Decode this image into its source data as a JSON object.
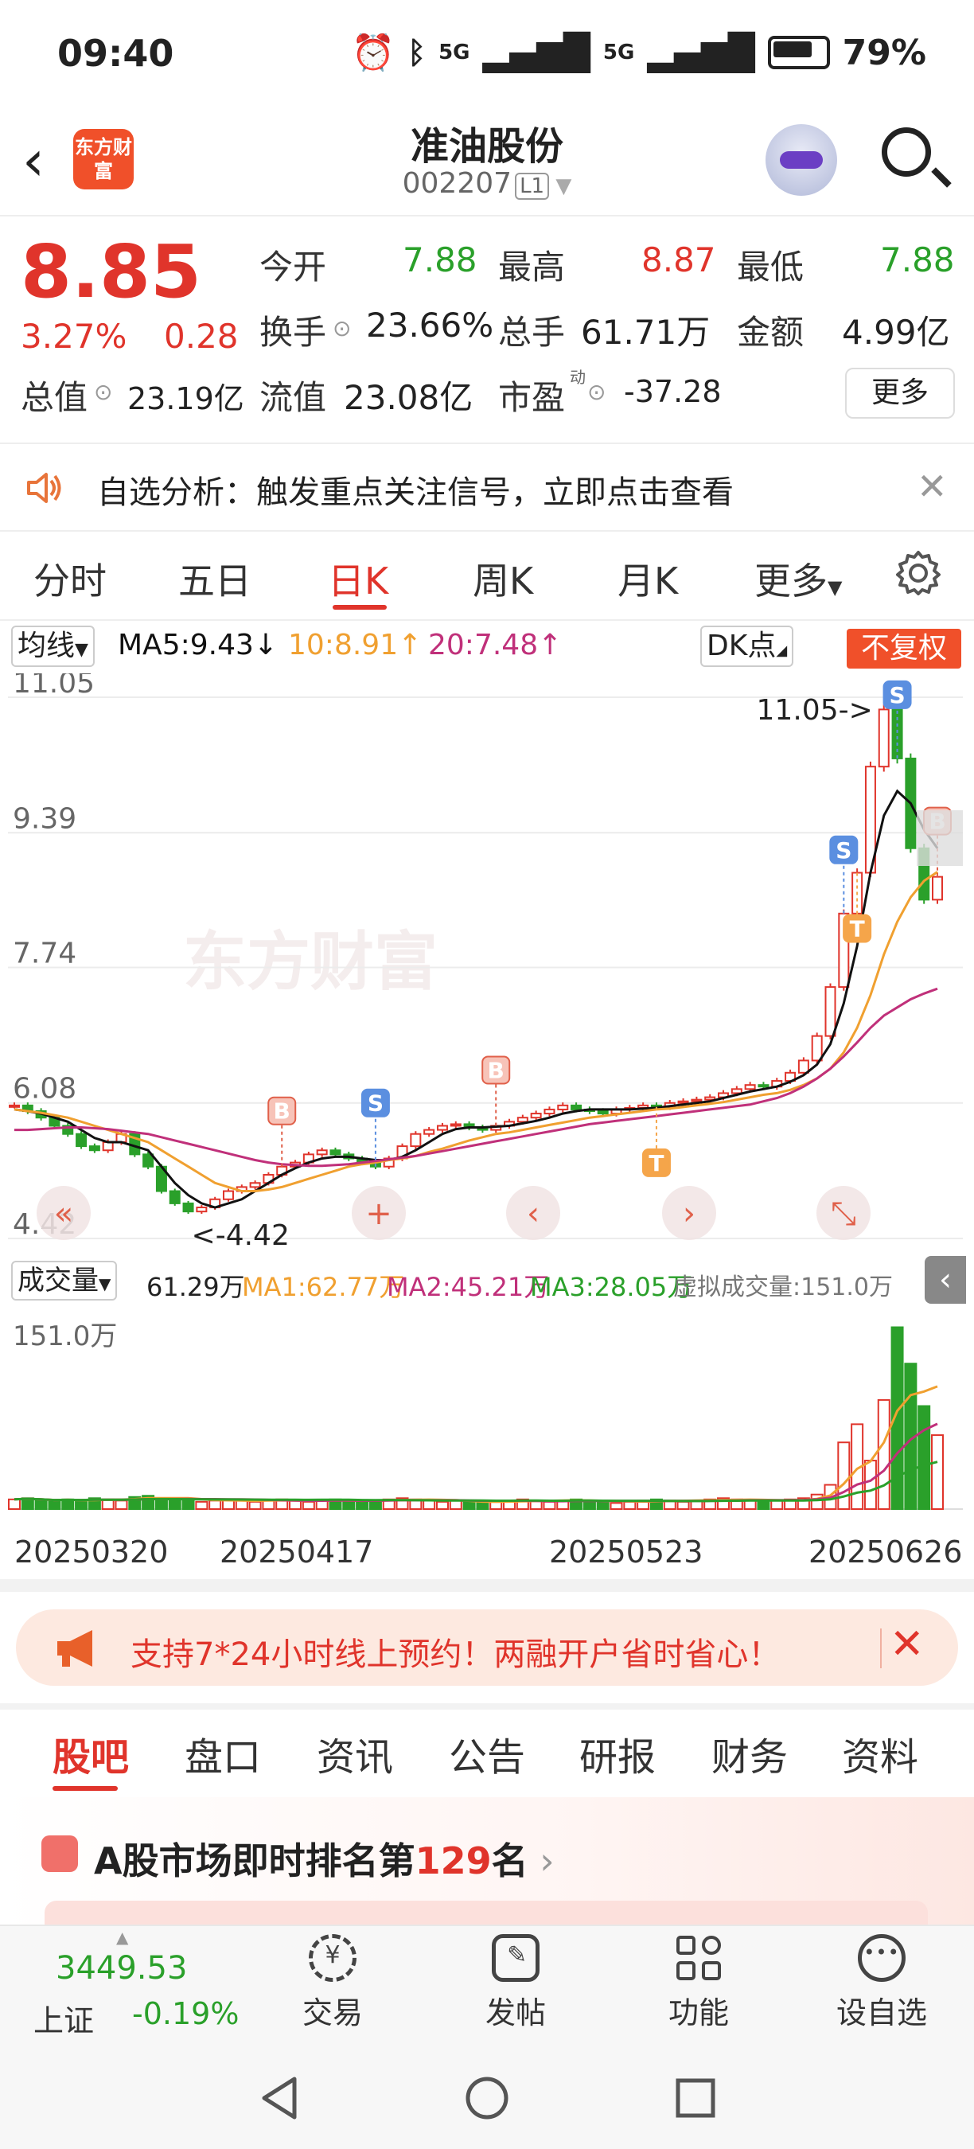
{
  "status_bar": {
    "time": "09:40",
    "battery": "79%",
    "net1": "5G",
    "net2": "5G"
  },
  "header": {
    "title": "准油股份",
    "code": "002207",
    "level": "L1",
    "logo_text": "东方财富"
  },
  "quote": {
    "price": "8.85",
    "pct": "3.27%",
    "change": "0.28",
    "open_label": "今开",
    "open": "7.88",
    "high_label": "最高",
    "high": "8.87",
    "low_label": "最低",
    "low": "7.88",
    "turnover_label": "换手",
    "turnover": "23.66%",
    "volume_label": "总手",
    "volume": "61.71万",
    "amount_label": "金额",
    "amount": "4.99亿",
    "mktcap_label": "总值",
    "mktcap": "23.19亿",
    "float_label": "流值",
    "float": "23.08亿",
    "pe_label": "市盈",
    "pe_sup": "动",
    "pe": "-37.28",
    "more": "更多"
  },
  "notice": {
    "text": "自选分析：触发重点关注信号，立即点击查看"
  },
  "kline_tabs": [
    "分时",
    "五日",
    "日K",
    "周K",
    "月K",
    "更多"
  ],
  "ma_bar": {
    "selector": "均线",
    "ma5": "MA5:9.43",
    "ma10": "10:8.91",
    "ma20": "20:7.48",
    "dk": "DK点",
    "fq": "不复权"
  },
  "colors": {
    "up": "#e0342b",
    "down": "#2aa02a",
    "ma5": "#111111",
    "ma10": "#f0a030",
    "ma20": "#c0307a",
    "accent": "#f0502a"
  },
  "chart_data": {
    "type": "candlestick",
    "y_ticks": [
      "11.05",
      "9.39",
      "7.74",
      "6.08",
      "4.42"
    ],
    "ylim": [
      4.42,
      11.05
    ],
    "max_label": "11.05->",
    "min_label": "<-4.42",
    "x_labels": [
      "20250320",
      "20250417",
      "20250523",
      "20250626"
    ],
    "closes": [
      6.05,
      5.98,
      5.9,
      5.8,
      5.7,
      5.55,
      5.5,
      5.6,
      5.7,
      5.45,
      5.3,
      5.0,
      4.85,
      4.75,
      4.8,
      4.9,
      5.0,
      5.05,
      5.1,
      5.2,
      5.3,
      5.35,
      5.45,
      5.5,
      5.45,
      5.4,
      5.35,
      5.3,
      5.4,
      5.55,
      5.7,
      5.75,
      5.8,
      5.82,
      5.78,
      5.75,
      5.8,
      5.85,
      5.9,
      5.95,
      6.0,
      6.05,
      6.0,
      5.98,
      5.95,
      6.0,
      6.02,
      6.05,
      6.03,
      6.08,
      6.1,
      6.12,
      6.15,
      6.2,
      6.25,
      6.3,
      6.28,
      6.35,
      6.45,
      6.6,
      6.9,
      7.5,
      8.4,
      8.9,
      10.2,
      10.9,
      10.3,
      9.2,
      8.57,
      8.85
    ],
    "ma5": [
      6.0,
      5.98,
      5.95,
      5.9,
      5.85,
      5.75,
      5.65,
      5.6,
      5.6,
      5.55,
      5.5,
      5.3,
      5.1,
      4.95,
      4.85,
      4.8,
      4.85,
      4.9,
      5.0,
      5.1,
      5.2,
      5.28,
      5.35,
      5.4,
      5.42,
      5.42,
      5.4,
      5.38,
      5.38,
      5.42,
      5.5,
      5.6,
      5.7,
      5.76,
      5.78,
      5.78,
      5.79,
      5.8,
      5.83,
      5.86,
      5.9,
      5.95,
      5.98,
      6.0,
      6.0,
      6.0,
      6.0,
      6.01,
      6.02,
      6.04,
      6.06,
      6.08,
      6.1,
      6.14,
      6.18,
      6.22,
      6.25,
      6.28,
      6.34,
      6.42,
      6.55,
      6.8,
      7.3,
      8.0,
      8.9,
      9.6,
      9.9,
      9.75,
      9.43,
      9.2
    ],
    "ma10": [
      6.0,
      5.98,
      5.96,
      5.93,
      5.9,
      5.85,
      5.8,
      5.75,
      5.7,
      5.65,
      5.6,
      5.5,
      5.4,
      5.3,
      5.2,
      5.1,
      5.05,
      5.0,
      5.0,
      5.02,
      5.05,
      5.1,
      5.15,
      5.2,
      5.25,
      5.3,
      5.33,
      5.35,
      5.38,
      5.4,
      5.43,
      5.48,
      5.52,
      5.57,
      5.62,
      5.66,
      5.7,
      5.72,
      5.75,
      5.78,
      5.81,
      5.84,
      5.87,
      5.9,
      5.92,
      5.94,
      5.96,
      5.98,
      6.0,
      6.01,
      6.03,
      6.05,
      6.07,
      6.09,
      6.12,
      6.15,
      6.18,
      6.2,
      6.24,
      6.3,
      6.38,
      6.5,
      6.7,
      7.0,
      7.4,
      7.9,
      8.3,
      8.6,
      8.8,
      8.91
    ],
    "ma20": [
      5.75,
      5.75,
      5.76,
      5.77,
      5.78,
      5.78,
      5.77,
      5.76,
      5.74,
      5.72,
      5.7,
      5.66,
      5.62,
      5.58,
      5.54,
      5.5,
      5.46,
      5.42,
      5.38,
      5.35,
      5.33,
      5.32,
      5.31,
      5.31,
      5.32,
      5.33,
      5.35,
      5.37,
      5.39,
      5.41,
      5.43,
      5.46,
      5.49,
      5.52,
      5.55,
      5.58,
      5.61,
      5.64,
      5.67,
      5.7,
      5.73,
      5.76,
      5.79,
      5.82,
      5.84,
      5.86,
      5.88,
      5.9,
      5.92,
      5.94,
      5.96,
      5.98,
      6.0,
      6.02,
      6.04,
      6.06,
      6.1,
      6.14,
      6.2,
      6.28,
      6.38,
      6.5,
      6.65,
      6.82,
      7.0,
      7.15,
      7.25,
      7.35,
      7.42,
      7.48
    ],
    "signals": [
      {
        "label": "B",
        "i": 20,
        "kind": "buy"
      },
      {
        "label": "S",
        "i": 27,
        "kind": "sell"
      },
      {
        "label": "B",
        "i": 36,
        "kind": "buy"
      },
      {
        "label": "S",
        "i": 62,
        "kind": "sell"
      },
      {
        "label": "S",
        "i": 66,
        "kind": "sell"
      },
      {
        "label": "B",
        "i": 69,
        "kind": "buy"
      },
      {
        "label": "T",
        "i": 48,
        "kind": "t"
      },
      {
        "label": "T",
        "i": 63,
        "kind": "t"
      }
    ],
    "watermark": "东方财富"
  },
  "volume_bar": {
    "selector": "成交量",
    "vol": "61.29万",
    "ma1": "MA1:62.77万",
    "ma2": "MA2:45.21万",
    "ma3": "MA3:28.05万",
    "virtual": "虚拟成交量:151.0万",
    "max_label": "151.0万"
  },
  "volume_data": {
    "ylim": [
      0,
      151.0
    ],
    "values": [
      8,
      9,
      7,
      6,
      8,
      7,
      9,
      8,
      7,
      10,
      11,
      9,
      8,
      7,
      6,
      7,
      8,
      7,
      6,
      7,
      8,
      7,
      6,
      7,
      8,
      7,
      6,
      7,
      8,
      9,
      8,
      7,
      6,
      7,
      6,
      5,
      6,
      7,
      8,
      7,
      6,
      7,
      8,
      7,
      6,
      5,
      6,
      7,
      8,
      7,
      6,
      7,
      8,
      9,
      8,
      7,
      6,
      7,
      8,
      9,
      12,
      20,
      55,
      70,
      40,
      90,
      150,
      120,
      85,
      61
    ]
  },
  "ad": {
    "text": "支持7*24小时线上预约！两融开户省时省心！"
  },
  "bottom_tabs": [
    "股吧",
    "盘口",
    "资讯",
    "公告",
    "研报",
    "财务",
    "资料"
  ],
  "rank": {
    "prefix": "A股市场即时排名第",
    "num": "129",
    "suffix": "名"
  },
  "index": {
    "value": "3449.53",
    "name": "上证",
    "pct": "-0.19%"
  },
  "nav": [
    {
      "label": "交易",
      "icon": "yen-exchange-icon"
    },
    {
      "label": "发帖",
      "icon": "edit-post-icon"
    },
    {
      "label": "功能",
      "icon": "grid-apps-icon"
    },
    {
      "label": "设自选",
      "icon": "more-dots-icon"
    }
  ]
}
